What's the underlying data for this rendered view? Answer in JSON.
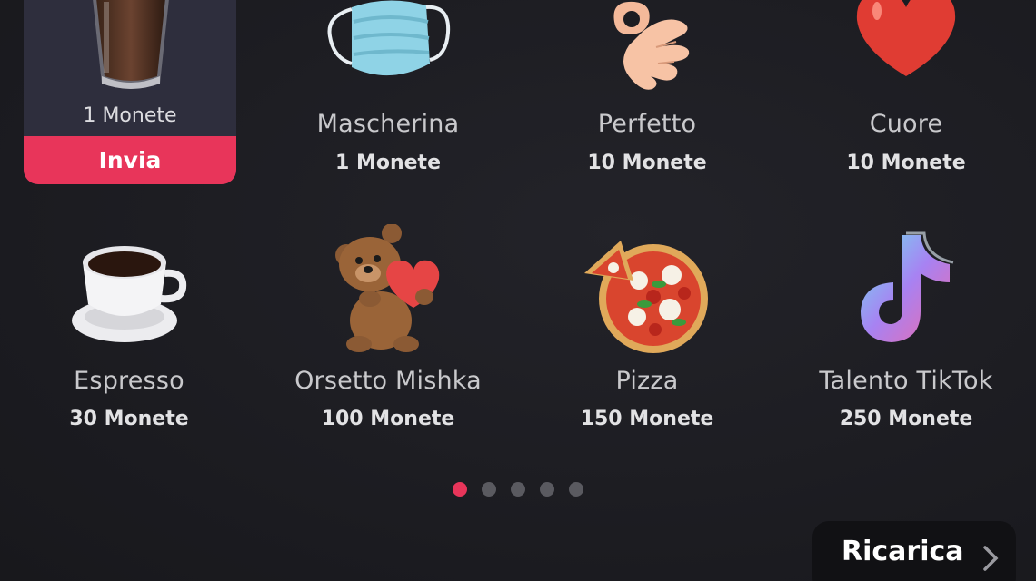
{
  "selected_gift": {
    "price": "1 Monete",
    "action_label": "Invia",
    "icon": "glass-coffee-icon"
  },
  "gifts_row1": [
    {
      "name": "Mascherina",
      "price": "1 Monete",
      "icon": "face-mask-icon"
    },
    {
      "name": "Perfetto",
      "price": "10 Monete",
      "icon": "ok-hand-icon"
    },
    {
      "name": "Cuore",
      "price": "10 Monete",
      "icon": "heart-icon"
    }
  ],
  "gifts_row2": [
    {
      "name": "Espresso",
      "price": "30 Monete",
      "icon": "espresso-cup-icon"
    },
    {
      "name": "Orsetto Mishka",
      "price": "100 Monete",
      "icon": "teddy-bear-icon"
    },
    {
      "name": "Pizza",
      "price": "150 Monete",
      "icon": "pizza-icon"
    },
    {
      "name": "Talento TikTok",
      "price": "250 Monete",
      "icon": "tiktok-note-icon"
    }
  ],
  "pagination": {
    "pages": 5,
    "current": 1
  },
  "recharge": {
    "label": "Ricarica"
  },
  "colors": {
    "accent": "#e8355a",
    "background": "#1d1d22",
    "card": "#2e2e3d"
  }
}
